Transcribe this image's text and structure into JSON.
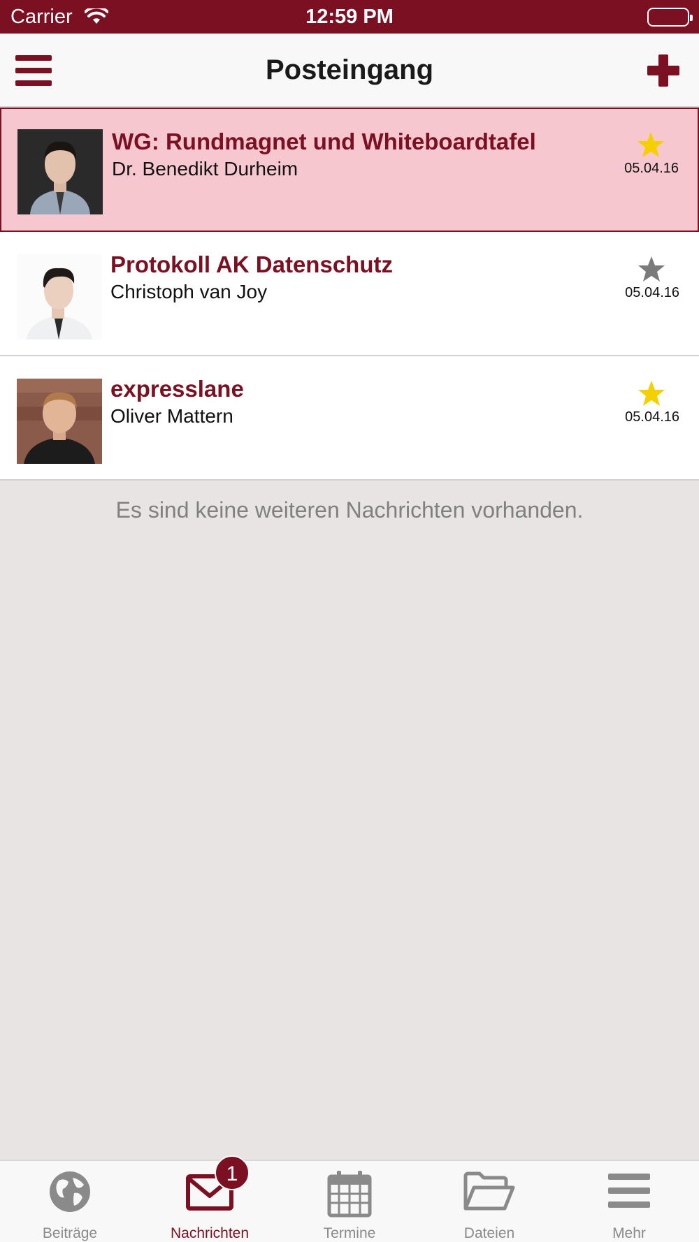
{
  "status_bar": {
    "carrier": "Carrier",
    "time": "12:59 PM"
  },
  "nav": {
    "title": "Posteingang"
  },
  "messages": [
    {
      "subject": "WG: Rundmagnet und Whiteboardtafel",
      "sender": "Dr. Benedikt Durheim",
      "date": "05.04.16",
      "starred": true,
      "selected": true
    },
    {
      "subject": "Protokoll AK Datenschutz",
      "sender": "Christoph van Joy",
      "date": "05.04.16",
      "starred": false,
      "selected": false
    },
    {
      "subject": "expresslane",
      "sender": "Oliver Mattern",
      "date": "05.04.16",
      "starred": true,
      "selected": false
    }
  ],
  "empty_note": "Es sind keine weiteren Nachrichten vorhanden.",
  "tabs": [
    {
      "label": "Beiträge",
      "icon": "globe-icon",
      "active": false
    },
    {
      "label": "Nachrichten",
      "icon": "envelope-icon",
      "active": true,
      "badge": "1"
    },
    {
      "label": "Termine",
      "icon": "calendar-icon",
      "active": false
    },
    {
      "label": "Dateien",
      "icon": "folder-icon",
      "active": false
    },
    {
      "label": "Mehr",
      "icon": "menu-icon",
      "active": false
    }
  ],
  "colors": {
    "brand": "#7a1022",
    "selected_row": "#f7c7d0",
    "star_on": "#f5d000",
    "star_off": "#7a7a7a",
    "background": "#e8e4e4"
  }
}
